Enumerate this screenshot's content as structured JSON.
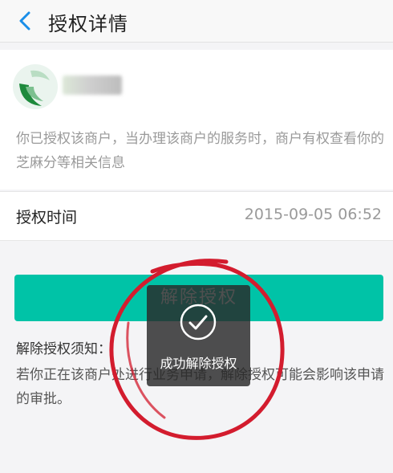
{
  "header": {
    "title": "授权详情",
    "back_icon": "chevron-left-icon"
  },
  "merchant": {
    "logo_icon": "merchant-logo",
    "description": "你已授权该商户，当办理该商户的服务时，商户有权查看你的芝麻分等相关信息"
  },
  "auth_time": {
    "label": "授权时间",
    "value": "2015-09-05 06:52"
  },
  "actions": {
    "revoke_label": "解除授权"
  },
  "notes": {
    "title": "解除授权须知：",
    "body": "若你正在该商户处进行业务申请，解除授权可能会影响该申请的审批。"
  },
  "toast": {
    "icon": "check-circle-icon",
    "text": "成功解除授权"
  },
  "colors": {
    "accent": "#00c3a7",
    "back_arrow": "#1a8ee8",
    "annotation": "#d31c2e"
  }
}
